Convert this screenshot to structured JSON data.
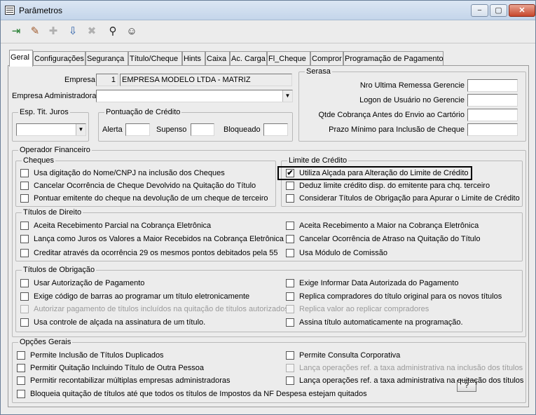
{
  "window": {
    "title": "Parâmetros",
    "minimize": "−",
    "maximize": "▢",
    "close": "✕"
  },
  "toolbar": {
    "buttons": [
      "exit-icon",
      "eraser-icon",
      "new-icon",
      "save-icon",
      "delete-icon",
      "binoculars-icon",
      "help-icon"
    ]
  },
  "tabs": [
    "Geral",
    "Configurações",
    "Segurança",
    "Título/Cheque",
    "Hints",
    "Caixa",
    "Ac. Carga",
    "Fl_Cheque",
    "Compror",
    "Programação de Pagamento"
  ],
  "empresa": {
    "label": "Empresa",
    "code": "1",
    "name": "EMPRESA MODELO LTDA - MATRIZ"
  },
  "empresa_adm": {
    "label": "Empresa  Administradora",
    "value": ""
  },
  "esp_tit": {
    "legend": "Esp. Tit. Juros",
    "value": ""
  },
  "pontuacao": {
    "legend": "Pontuação de Crédito",
    "alerta": "Alerta",
    "supenso": "Supenso",
    "bloqueado": "Bloqueado"
  },
  "serasa": {
    "legend": "Serasa",
    "fields": [
      "Nro Ultima Remessa Gerencie",
      "Logon de Usuário no Gerencie",
      "Qtde Cobrança  Antes do Envio ao Cartório",
      "Prazo Mínimo para Inclusão de Cheque"
    ]
  },
  "operador": {
    "legend": "Operador Financeiro"
  },
  "cheques": {
    "legend": "Cheques",
    "items": [
      "Usa digitação do Nome/CNPJ na inclusão dos Cheques",
      "Cancelar Ocorrência de Cheque Devolvido na Quitação do Título",
      "Pontuar emitente do cheque na devolução de um cheque de terceiro"
    ]
  },
  "limite": {
    "legend": "Limite de Crédito",
    "items": [
      "Utiliza Alçada para Alteração do Limite de Crédito",
      "Deduz limite crédito disp. do emitente para chq. terceiro",
      "Considerar Títulos de Obrigação para Apurar o Limite de Crédito"
    ],
    "check": "✔"
  },
  "direito": {
    "legend": "Títulos de Direito",
    "left": [
      "Aceita Recebimento Parcial na Cobrança Eletrônica",
      "Lança como Juros os Valores a Maior Recebidos na Cobrança Eletrônica",
      "Creditar através da ocorrência 29 os mesmos pontos debitados pela 55"
    ],
    "right": [
      "Aceita Recebimento a Maior na Cobrança Eletrônica",
      "Cancelar Ocorrência de Atraso na Quitação do Título",
      "Usa Módulo de Comissão"
    ]
  },
  "obrigacao": {
    "legend": "Títulos de Obrigação",
    "left": [
      "Usar Autorização de Pagamento",
      "Exige código de barras ao programar um título eletronicamente",
      "Autorizar pagamento de títulos incluídos na quitação de títulos autorizados",
      "Usa controle de alçada na assinatura de um título."
    ],
    "right": [
      "Exige Informar Data Autorizada do Pagamento",
      "Replica compradores do título original para os novos títulos",
      "Replica valor ao replicar compradores",
      "Assina título automaticamente na programação."
    ],
    "help_button": "?"
  },
  "opcoes": {
    "legend": "Opções Gerais",
    "left": [
      "Permite Inclusão de Títulos Duplicados",
      "Permitir Quitação Incluindo Título de Outra Pessoa",
      "Permitir recontabilizar múltiplas empresas administradoras",
      "Bloqueia quitação de títulos até que todos os títulos de Impostos da NF Despesa estejam quitados"
    ],
    "right": [
      "Permite Consulta Corporativa",
      "Lança operações ref. a taxa administrativa na inclusão dos títulos",
      "Lança operações ref. a taxa administrativa na quitação dos títulos"
    ]
  }
}
